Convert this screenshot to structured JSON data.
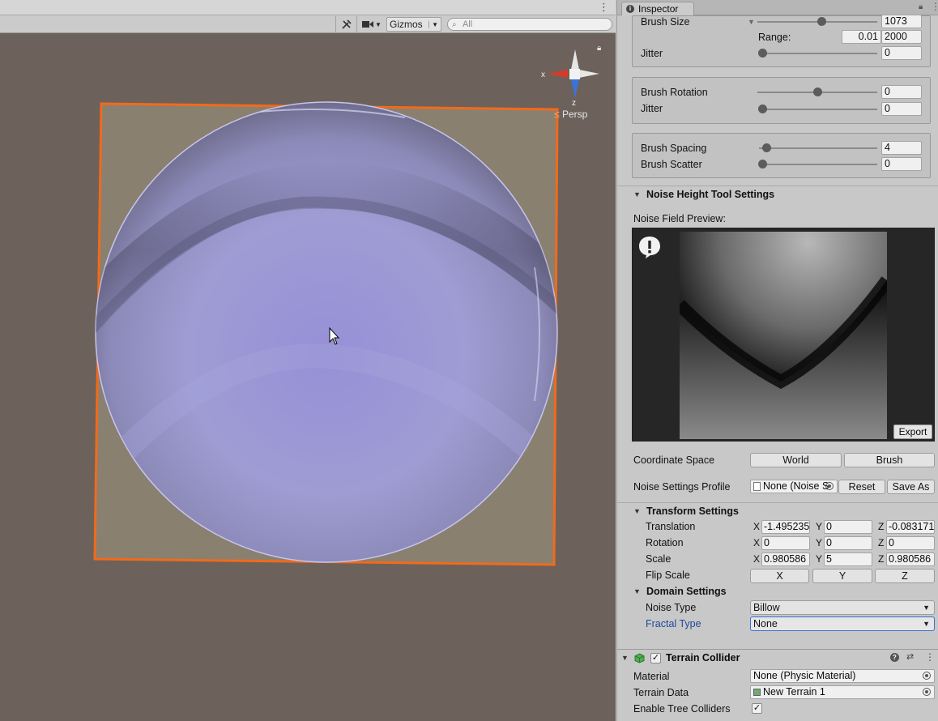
{
  "scene": {
    "gizmos_label": "Gizmos",
    "search_placeholder": "All",
    "persp_label": "Persp",
    "axis_x": "x",
    "axis_z": "z"
  },
  "inspector": {
    "tab_label": "Inspector",
    "brush_size": {
      "label": "Brush Size",
      "value": "1073",
      "slider_fraction": 0.53
    },
    "range": {
      "label": "Range:",
      "min": "0.01",
      "max": "2000"
    },
    "size_jitter": {
      "label": "Jitter",
      "value": "0",
      "slider_fraction": 0.0
    },
    "brush_rotation": {
      "label": "Brush Rotation",
      "value": "0",
      "slider_fraction": 0.5
    },
    "rotation_jitter": {
      "label": "Jitter",
      "value": "0",
      "slider_fraction": 0.0
    },
    "brush_spacing": {
      "label": "Brush Spacing",
      "value": "4",
      "slider_fraction": 0.04
    },
    "brush_scatter": {
      "label": "Brush Scatter",
      "value": "0",
      "slider_fraction": 0.0
    },
    "noise_section_title": "Noise Height Tool Settings",
    "noise_preview_label": "Noise Field Preview:",
    "export_label": "Export",
    "coordinate_space": {
      "label": "Coordinate Space",
      "world": "World",
      "brush": "Brush"
    },
    "noise_profile": {
      "label": "Noise Settings Profile",
      "value": "None (Noise S",
      "reset": "Reset",
      "save_as": "Save As"
    },
    "transform_title": "Transform Settings",
    "translation": {
      "label": "Translation",
      "x": "-1.495235",
      "y": "0",
      "z": "-0.083171"
    },
    "rotation": {
      "label": "Rotation",
      "x": "0",
      "y": "0",
      "z": "0"
    },
    "scale": {
      "label": "Scale",
      "x": "0.980586",
      "y": "5",
      "z": "0.980586"
    },
    "flip_scale": {
      "label": "Flip Scale",
      "x": "X",
      "y": "Y",
      "z": "Z"
    },
    "axis_labels": {
      "x": "X",
      "y": "Y",
      "z": "Z"
    },
    "domain_title": "Domain Settings",
    "noise_type": {
      "label": "Noise Type",
      "value": "Billow"
    },
    "fractal_type": {
      "label": "Fractal Type",
      "value": "None"
    },
    "collider": {
      "title": "Terrain Collider",
      "help": "?",
      "checked": "✓",
      "material": {
        "label": "Material",
        "value": "None (Physic Material)"
      },
      "terrain_data": {
        "label": "Terrain Data",
        "value": "New Terrain 1"
      },
      "tree_colliders": {
        "label": "Enable Tree Colliders",
        "checked": "✓"
      }
    }
  },
  "colors": {
    "selection_outline": "#f26a1b",
    "terrain": "#8a8070",
    "brush_preview": "#9a98d2",
    "scene_bg": "#6c625b",
    "fractal_label_blue": "#1c4a9a"
  }
}
